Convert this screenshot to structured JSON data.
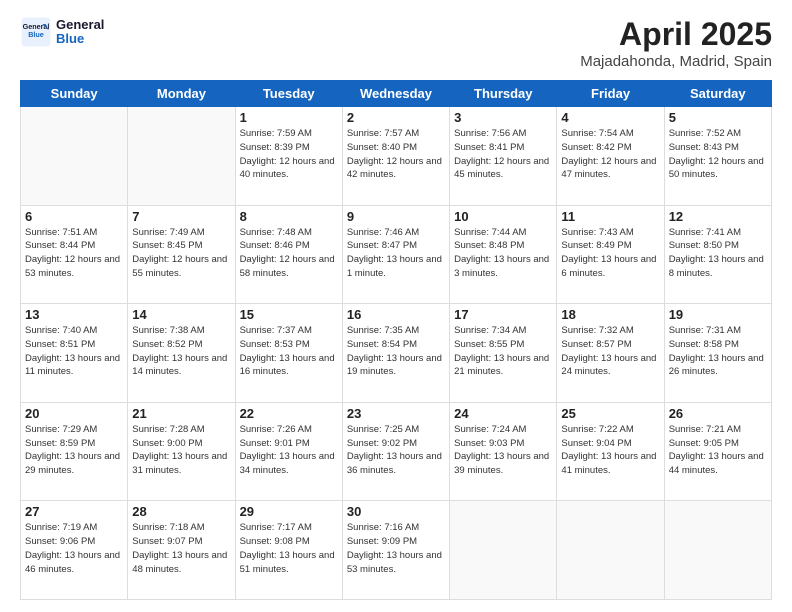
{
  "header": {
    "logo_line1": "General",
    "logo_line2": "Blue",
    "title": "April 2025",
    "subtitle": "Majadahonda, Madrid, Spain"
  },
  "days_of_week": [
    "Sunday",
    "Monday",
    "Tuesday",
    "Wednesday",
    "Thursday",
    "Friday",
    "Saturday"
  ],
  "weeks": [
    [
      {
        "num": "",
        "info": ""
      },
      {
        "num": "",
        "info": ""
      },
      {
        "num": "1",
        "info": "Sunrise: 7:59 AM\nSunset: 8:39 PM\nDaylight: 12 hours and 40 minutes."
      },
      {
        "num": "2",
        "info": "Sunrise: 7:57 AM\nSunset: 8:40 PM\nDaylight: 12 hours and 42 minutes."
      },
      {
        "num": "3",
        "info": "Sunrise: 7:56 AM\nSunset: 8:41 PM\nDaylight: 12 hours and 45 minutes."
      },
      {
        "num": "4",
        "info": "Sunrise: 7:54 AM\nSunset: 8:42 PM\nDaylight: 12 hours and 47 minutes."
      },
      {
        "num": "5",
        "info": "Sunrise: 7:52 AM\nSunset: 8:43 PM\nDaylight: 12 hours and 50 minutes."
      }
    ],
    [
      {
        "num": "6",
        "info": "Sunrise: 7:51 AM\nSunset: 8:44 PM\nDaylight: 12 hours and 53 minutes."
      },
      {
        "num": "7",
        "info": "Sunrise: 7:49 AM\nSunset: 8:45 PM\nDaylight: 12 hours and 55 minutes."
      },
      {
        "num": "8",
        "info": "Sunrise: 7:48 AM\nSunset: 8:46 PM\nDaylight: 12 hours and 58 minutes."
      },
      {
        "num": "9",
        "info": "Sunrise: 7:46 AM\nSunset: 8:47 PM\nDaylight: 13 hours and 1 minute."
      },
      {
        "num": "10",
        "info": "Sunrise: 7:44 AM\nSunset: 8:48 PM\nDaylight: 13 hours and 3 minutes."
      },
      {
        "num": "11",
        "info": "Sunrise: 7:43 AM\nSunset: 8:49 PM\nDaylight: 13 hours and 6 minutes."
      },
      {
        "num": "12",
        "info": "Sunrise: 7:41 AM\nSunset: 8:50 PM\nDaylight: 13 hours and 8 minutes."
      }
    ],
    [
      {
        "num": "13",
        "info": "Sunrise: 7:40 AM\nSunset: 8:51 PM\nDaylight: 13 hours and 11 minutes."
      },
      {
        "num": "14",
        "info": "Sunrise: 7:38 AM\nSunset: 8:52 PM\nDaylight: 13 hours and 14 minutes."
      },
      {
        "num": "15",
        "info": "Sunrise: 7:37 AM\nSunset: 8:53 PM\nDaylight: 13 hours and 16 minutes."
      },
      {
        "num": "16",
        "info": "Sunrise: 7:35 AM\nSunset: 8:54 PM\nDaylight: 13 hours and 19 minutes."
      },
      {
        "num": "17",
        "info": "Sunrise: 7:34 AM\nSunset: 8:55 PM\nDaylight: 13 hours and 21 minutes."
      },
      {
        "num": "18",
        "info": "Sunrise: 7:32 AM\nSunset: 8:57 PM\nDaylight: 13 hours and 24 minutes."
      },
      {
        "num": "19",
        "info": "Sunrise: 7:31 AM\nSunset: 8:58 PM\nDaylight: 13 hours and 26 minutes."
      }
    ],
    [
      {
        "num": "20",
        "info": "Sunrise: 7:29 AM\nSunset: 8:59 PM\nDaylight: 13 hours and 29 minutes."
      },
      {
        "num": "21",
        "info": "Sunrise: 7:28 AM\nSunset: 9:00 PM\nDaylight: 13 hours and 31 minutes."
      },
      {
        "num": "22",
        "info": "Sunrise: 7:26 AM\nSunset: 9:01 PM\nDaylight: 13 hours and 34 minutes."
      },
      {
        "num": "23",
        "info": "Sunrise: 7:25 AM\nSunset: 9:02 PM\nDaylight: 13 hours and 36 minutes."
      },
      {
        "num": "24",
        "info": "Sunrise: 7:24 AM\nSunset: 9:03 PM\nDaylight: 13 hours and 39 minutes."
      },
      {
        "num": "25",
        "info": "Sunrise: 7:22 AM\nSunset: 9:04 PM\nDaylight: 13 hours and 41 minutes."
      },
      {
        "num": "26",
        "info": "Sunrise: 7:21 AM\nSunset: 9:05 PM\nDaylight: 13 hours and 44 minutes."
      }
    ],
    [
      {
        "num": "27",
        "info": "Sunrise: 7:19 AM\nSunset: 9:06 PM\nDaylight: 13 hours and 46 minutes."
      },
      {
        "num": "28",
        "info": "Sunrise: 7:18 AM\nSunset: 9:07 PM\nDaylight: 13 hours and 48 minutes."
      },
      {
        "num": "29",
        "info": "Sunrise: 7:17 AM\nSunset: 9:08 PM\nDaylight: 13 hours and 51 minutes."
      },
      {
        "num": "30",
        "info": "Sunrise: 7:16 AM\nSunset: 9:09 PM\nDaylight: 13 hours and 53 minutes."
      },
      {
        "num": "",
        "info": ""
      },
      {
        "num": "",
        "info": ""
      },
      {
        "num": "",
        "info": ""
      }
    ]
  ]
}
